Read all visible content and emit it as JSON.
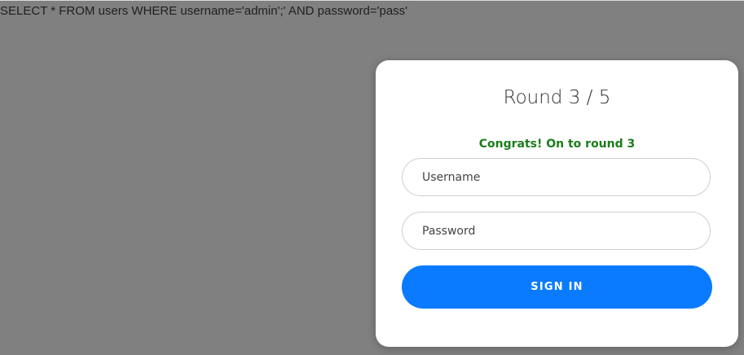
{
  "query": {
    "text": "SELECT * FROM users WHERE username='admin';' AND password='pass'"
  },
  "login_card": {
    "title": "Round 3 / 5",
    "status_message": "Congrats! On to round 3",
    "username_placeholder": "Username",
    "password_placeholder": "Password",
    "signin_label": "SIGN IN"
  },
  "colors": {
    "background": "#808080",
    "card": "#ffffff",
    "success_text": "#1b7d1b",
    "button": "#0a7bff"
  }
}
